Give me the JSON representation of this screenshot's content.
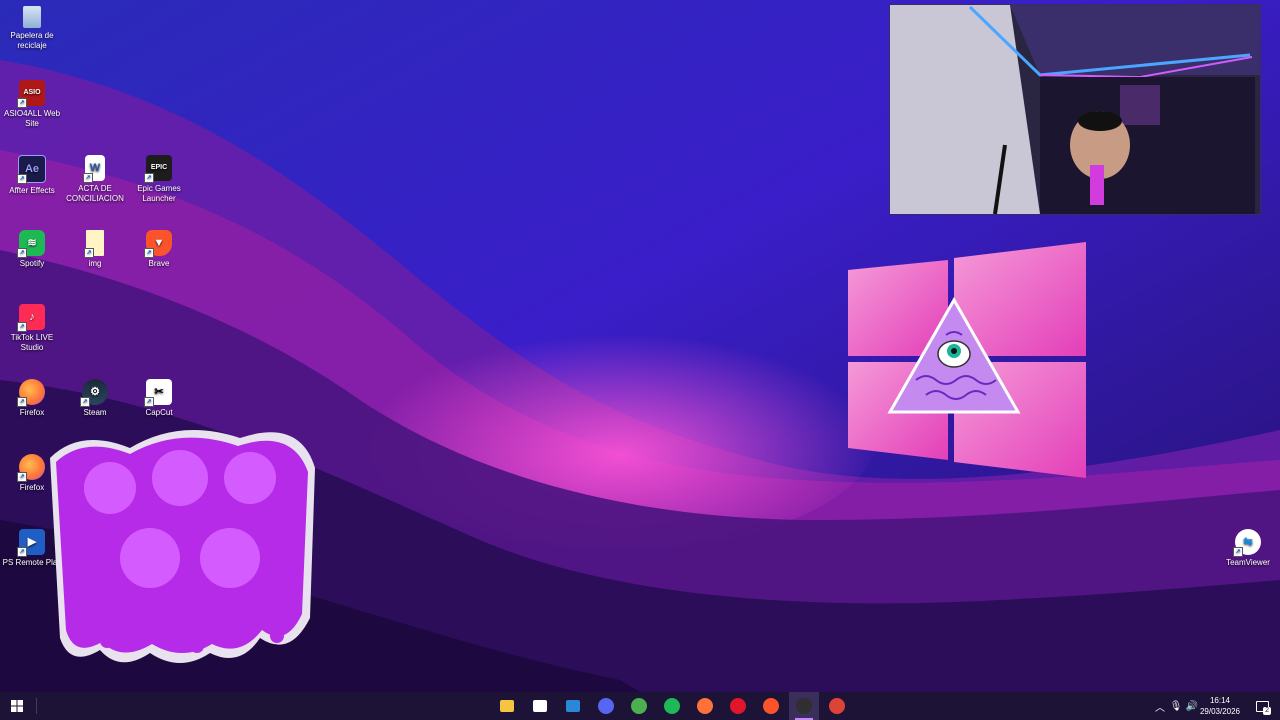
{
  "desktop": {
    "icons": [
      {
        "label": "Papelera de reciclaje",
        "icon": "recycle-bin-icon"
      },
      {
        "label": "ASIO4ALL Web Site",
        "icon": "asio4all-icon"
      },
      {
        "label": "Affter Effects",
        "icon": "after-effects-icon",
        "glyph_text": "Ae"
      },
      {
        "label": "ACTA DE CONCILIACION",
        "icon": "word-document-icon",
        "glyph_text": "W"
      },
      {
        "label": "Epic Games Launcher",
        "icon": "epic-games-icon",
        "glyph_text": "EPIC"
      },
      {
        "label": "Spotify",
        "icon": "spotify-icon"
      },
      {
        "label": "img",
        "icon": "folder-icon"
      },
      {
        "label": "Brave",
        "icon": "brave-icon"
      },
      {
        "label": "TikTok LIVE Studio",
        "icon": "tiktok-live-icon"
      },
      {
        "label": "Firefox",
        "icon": "firefox-icon"
      },
      {
        "label": "Steam",
        "icon": "steam-icon"
      },
      {
        "label": "CapCut",
        "icon": "capcut-icon"
      },
      {
        "label": "Firefox",
        "icon": "firefox-icon"
      },
      {
        "label": "PS Remote Play",
        "icon": "ps-remote-play-icon"
      },
      {
        "label": "TeamViewer",
        "icon": "teamviewer-icon"
      }
    ]
  },
  "colors": {
    "wallpaper_base": "#2a0f6e",
    "wallpaper_highlight": "#e04ac0",
    "taskbar": "#1c1336",
    "logo_pink": "#f06cc8",
    "sticker_purple": "#b52be8"
  },
  "taskbar": {
    "start_icon": "windows-start-icon",
    "pinned": [
      {
        "name": "file-explorer-icon",
        "color": "#f5c542"
      },
      {
        "name": "microsoft-store-icon",
        "color": "#ffffff"
      },
      {
        "name": "mail-icon",
        "color": "#2b88d8"
      },
      {
        "name": "discord-icon",
        "color": "#5865f2"
      },
      {
        "name": "chrome-icon",
        "color": "#4caf50"
      },
      {
        "name": "spotify-icon",
        "color": "#1db954"
      },
      {
        "name": "firefox-icon",
        "color": "#ff7139"
      },
      {
        "name": "opera-icon",
        "color": "#e0162b"
      },
      {
        "name": "brave-icon",
        "color": "#fb542b"
      },
      {
        "name": "obs-icon",
        "color": "#302e31",
        "active": true
      },
      {
        "name": "chrome-profile-icon",
        "color": "#db4437"
      }
    ],
    "tray": {
      "chevron": "chevron-up-icon",
      "mic": "microphone-icon",
      "volume": "volume-icon",
      "time": "16:14",
      "date": "29/03/2026",
      "notification_count": "2"
    }
  }
}
